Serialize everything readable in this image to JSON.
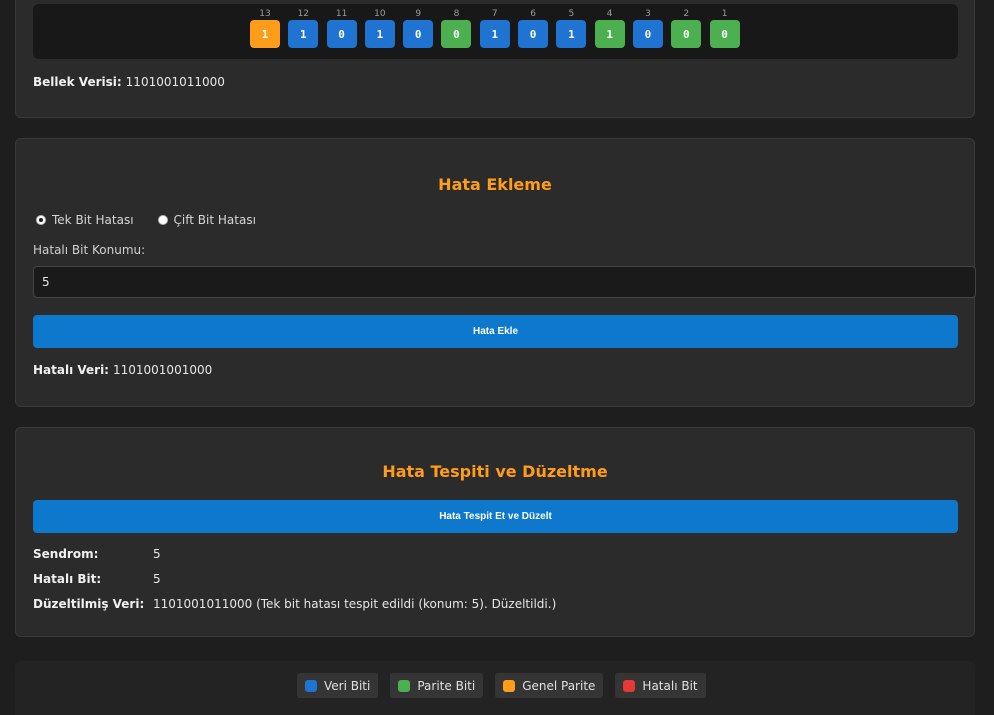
{
  "memory": {
    "bits": [
      {
        "pos": "13",
        "value": "1",
        "kind": "overall"
      },
      {
        "pos": "12",
        "value": "1",
        "kind": "data"
      },
      {
        "pos": "11",
        "value": "0",
        "kind": "data"
      },
      {
        "pos": "10",
        "value": "1",
        "kind": "data"
      },
      {
        "pos": "9",
        "value": "0",
        "kind": "data"
      },
      {
        "pos": "8",
        "value": "0",
        "kind": "parity"
      },
      {
        "pos": "7",
        "value": "1",
        "kind": "data"
      },
      {
        "pos": "6",
        "value": "0",
        "kind": "data"
      },
      {
        "pos": "5",
        "value": "1",
        "kind": "data"
      },
      {
        "pos": "4",
        "value": "1",
        "kind": "parity"
      },
      {
        "pos": "3",
        "value": "0",
        "kind": "data"
      },
      {
        "pos": "2",
        "value": "0",
        "kind": "parity"
      },
      {
        "pos": "1",
        "value": "0",
        "kind": "parity"
      }
    ],
    "label": "Bellek Verisi:",
    "value": "1101001011000"
  },
  "error_injection": {
    "title": "Hata Ekleme",
    "radio_single": "Tek Bit Hatası",
    "radio_double": "Çift Bit Hatası",
    "selected": "single",
    "position_label": "Hatalı Bit Konumu:",
    "position_value": "5",
    "button_label": "Hata Ekle",
    "result_label": "Hatalı Veri:",
    "result_value": "1101001001000"
  },
  "detection": {
    "title": "Hata Tespiti ve Düzeltme",
    "button_label": "Hata Tespit Et ve Düzelt",
    "syndrome_label": "Sendrom:",
    "syndrome_value": "5",
    "error_bit_label": "Hatalı Bit:",
    "error_bit_value": "5",
    "corrected_label": "Düzeltilmiş Veri:",
    "corrected_value": "1101001011000 (Tek bit hatası tespit edildi (konum: 5). Düzeltildi.)"
  },
  "legend": {
    "data_bit": "Veri Biti",
    "parity_bit": "Parite Biti",
    "overall_parity": "Genel Parite",
    "error_bit": "Hatalı Bit"
  },
  "colors": {
    "data": "#1e74d0",
    "parity": "#4caf50",
    "overall": "#ff9c1a",
    "error": "#e53935",
    "accent": "#ff9c1a",
    "button": "#0d78cc"
  }
}
